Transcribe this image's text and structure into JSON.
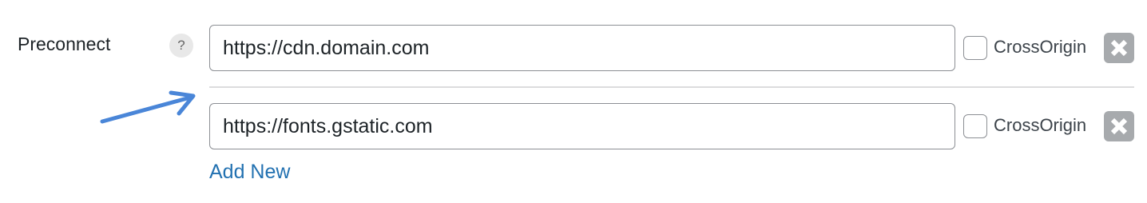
{
  "field": {
    "label": "Preconnect",
    "help_icon": "question-mark-icon",
    "help_glyph": "?"
  },
  "rows": [
    {
      "url": "https://cdn.domain.com",
      "crossorigin_label": "CrossOrigin",
      "crossorigin_checked": false,
      "remove_icon": "close-icon"
    },
    {
      "url": "https://fonts.gstatic.com",
      "crossorigin_label": "CrossOrigin",
      "crossorigin_checked": false,
      "remove_icon": "close-icon"
    }
  ],
  "add_new_label": "Add New",
  "annotation": {
    "icon": "arrow-icon",
    "color": "#4a86d8"
  },
  "colors": {
    "link": "#2271b1",
    "remove_button": "#a7aaad",
    "input_border": "#8c8f94"
  }
}
